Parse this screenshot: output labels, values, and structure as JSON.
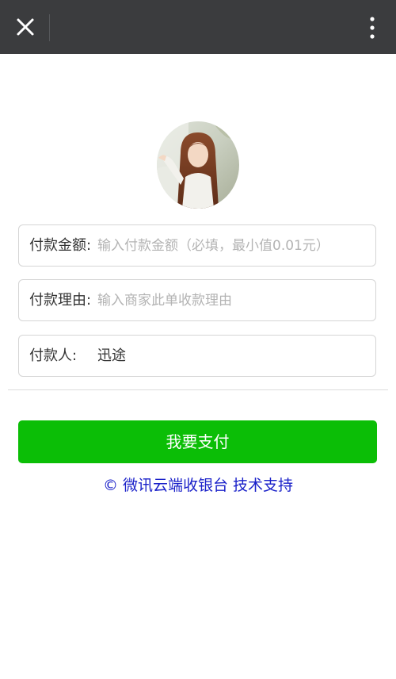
{
  "topbar": {
    "close_icon": "close-icon",
    "more_icon": "more-vertical-icon"
  },
  "avatar": {
    "description_icon": "profile-photo"
  },
  "form": {
    "amount": {
      "label": "付款金额:",
      "placeholder": "输入付款金额（必填，最小值0.01元）",
      "value": ""
    },
    "reason": {
      "label": "付款理由:",
      "placeholder": "输入商家此单收款理由",
      "value": ""
    },
    "payee": {
      "label": "付款人:",
      "value": "迅途"
    }
  },
  "pay_button": {
    "label": "我要支付",
    "color": "#0bbe06"
  },
  "footer": {
    "text": "© 微讯云端收银台 技术支持",
    "color": "#1a21c9"
  },
  "colors": {
    "topbar_bg": "#3b3c3e"
  }
}
